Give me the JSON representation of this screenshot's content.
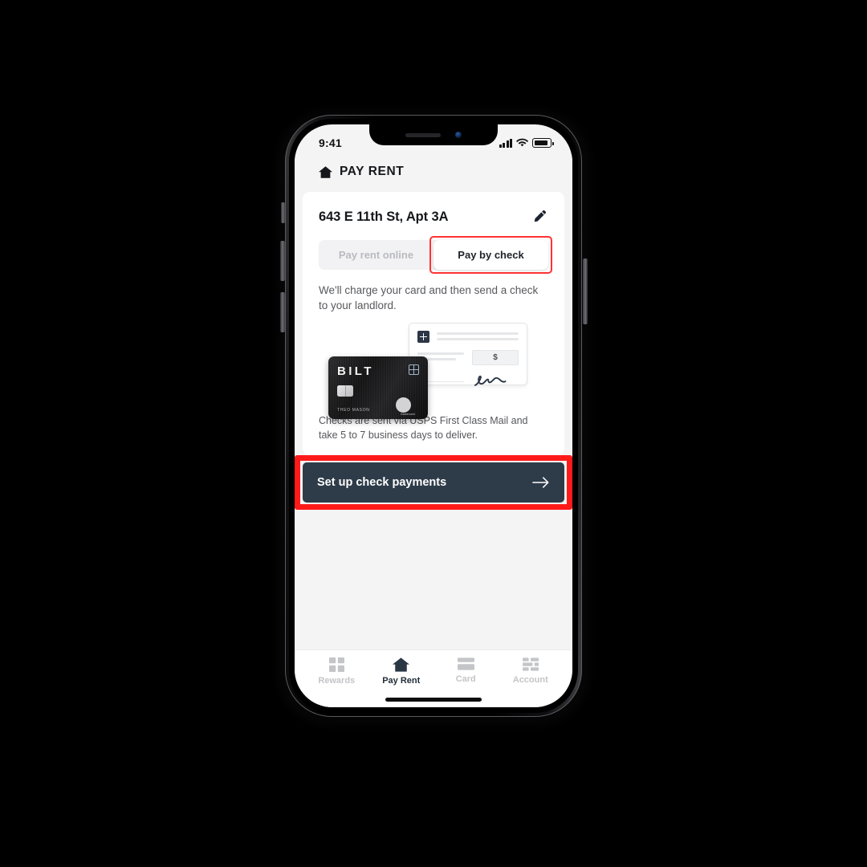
{
  "status_bar": {
    "time": "9:41",
    "signal_icon": "cellular-bars-icon",
    "wifi_icon": "wifi-icon",
    "battery_icon": "battery-icon"
  },
  "app_header": {
    "home_icon": "home-icon",
    "title": "PAY RENT"
  },
  "card": {
    "address": "643 E 11th St, Apt 3A",
    "edit_icon": "pencil-edit-icon",
    "tabs": [
      {
        "label": "Pay rent online",
        "active": false
      },
      {
        "label": "Pay by check",
        "active": true
      }
    ],
    "lead_text": "We'll charge your card and then send a check to your landlord.",
    "illustration": {
      "check_amount_symbol": "$",
      "check_logo_icon": "bilt-mark-icon",
      "signature_icon": "signature-icon",
      "credit_card": {
        "brand": "BILT",
        "cardholder": "THEO MASON",
        "network_icon": "mastercard-icon",
        "network_label": "mastercard",
        "chip_icon": "emv-chip-icon",
        "mark_icon": "bilt-mark-icon"
      }
    },
    "fineprint": "Checks are sent via USPS First Class Mail and take 5 to 7 business days to deliver."
  },
  "cta": {
    "label": "Set up check payments",
    "arrow_icon": "arrow-right-icon"
  },
  "tabbar": [
    {
      "label": "Rewards",
      "icon": "gift-icon",
      "active": false
    },
    {
      "label": "Pay Rent",
      "icon": "home-icon",
      "active": true
    },
    {
      "label": "Card",
      "icon": "credit-card-icon",
      "active": false
    },
    {
      "label": "Account",
      "icon": "grid-blocks-icon",
      "active": false
    }
  ],
  "annotations": {
    "highlight_color": "#ff1a1a",
    "targets": [
      "pay-by-check-tab",
      "set-up-check-payments-button"
    ]
  },
  "colors": {
    "screen_background": "#f4f4f4",
    "card_background": "#ffffff",
    "cta_background": "#2e3c49",
    "text_primary": "#15171a",
    "text_muted": "#58595c",
    "tab_inactive": "#c4c5c8"
  }
}
